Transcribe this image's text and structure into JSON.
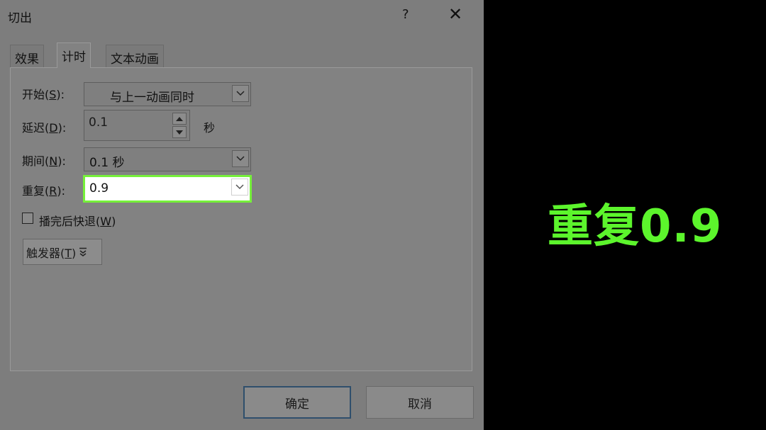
{
  "dialog": {
    "title": "切出",
    "help": "?",
    "close": "✕"
  },
  "tabs": [
    {
      "label": "效果",
      "active": false
    },
    {
      "label": "计时",
      "active": true
    },
    {
      "label": "文本动画",
      "active": false
    }
  ],
  "fields": {
    "start": {
      "label_pre": "开始(",
      "key": "S",
      "label_post": "):",
      "value": "与上一动画同时"
    },
    "delay": {
      "label_pre": "延迟(",
      "key": "D",
      "label_post": "):",
      "value": "0.1",
      "unit": "秒"
    },
    "duration": {
      "label_pre": "期间(",
      "key": "N",
      "label_post": "):",
      "value": "0.1 秒"
    },
    "repeat": {
      "label_pre": "重复(",
      "key": "R",
      "label_post": "):",
      "value": "0.9"
    }
  },
  "rewind": {
    "label_pre": "播完后快退(",
    "key": "W",
    "label_post": ")",
    "checked": false
  },
  "trigger": {
    "label_pre": "触发器(",
    "key": "T",
    "label_post": ")"
  },
  "buttons": {
    "ok": "确定",
    "cancel": "取消"
  },
  "caption": "重复0.9",
  "colors": {
    "highlight": "#76f03a",
    "caption": "#5cf52c"
  }
}
